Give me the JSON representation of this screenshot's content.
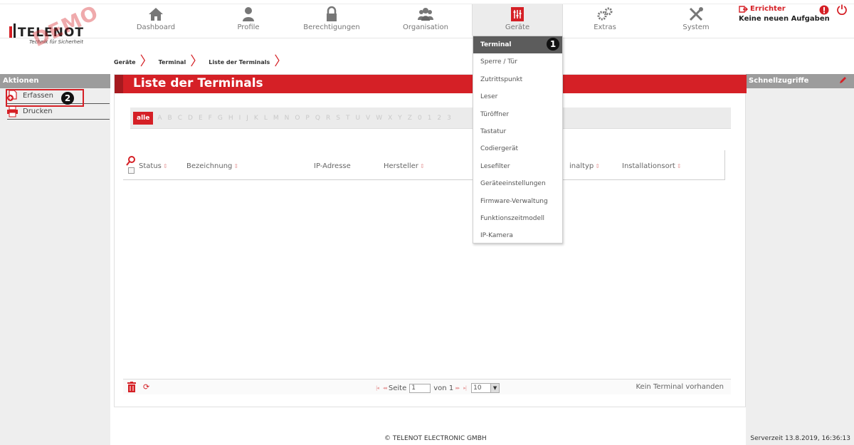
{
  "logo": {
    "brand": "TELENOT",
    "tagline": "Technik für Sicherheit",
    "watermark": "DEMO"
  },
  "nav": [
    {
      "label": "Dashboard",
      "icon": "house-icon"
    },
    {
      "label": "Profile",
      "icon": "person-icon"
    },
    {
      "label": "Berechtigungen",
      "icon": "lock-icon"
    },
    {
      "label": "Organisation",
      "icon": "group-icon"
    },
    {
      "label": "Geräte",
      "icon": "device-icon"
    },
    {
      "label": "Extras",
      "icon": "gears-icon"
    },
    {
      "label": "System",
      "icon": "tools-icon"
    }
  ],
  "user": {
    "name": "Errichter",
    "tasks": "Keine neuen Aufgaben"
  },
  "breadcrumb": [
    "Geräte",
    "Terminal",
    "Liste der Terminals"
  ],
  "sidebar": {
    "title": "Aktionen",
    "items": [
      {
        "label": "Erfassen",
        "icon": "add-document-icon"
      },
      {
        "label": "Drucken",
        "icon": "printer-icon"
      }
    ]
  },
  "right_sidebar": {
    "title": "Schnellzugriffe"
  },
  "main": {
    "title": "Liste der Terminals",
    "alpha_all": "alle",
    "letters": [
      "A",
      "B",
      "C",
      "D",
      "E",
      "F",
      "G",
      "H",
      "I",
      "J",
      "K",
      "L",
      "M",
      "N",
      "O",
      "P",
      "Q",
      "R",
      "S",
      "T",
      "U",
      "V",
      "W",
      "X",
      "Y",
      "Z",
      "0",
      "1",
      "2",
      "3"
    ],
    "columns": [
      "Status",
      "Bezeichnung",
      "IP-Adresse",
      "Hersteller",
      "Terminaltyp",
      "Installationsort"
    ],
    "columns_visible": [
      "Status",
      "Bezeichnung",
      "IP-Adresse",
      "Hersteller",
      "inaltyp",
      "Installationsort"
    ],
    "pager": {
      "page_label": "Seite",
      "page_value": "1",
      "of_label": "von 1",
      "page_size": "10"
    },
    "empty_text": "Kein Terminal vorhanden"
  },
  "dropdown": {
    "items": [
      "Terminal",
      "Sperre / Tür",
      "Zutrittspunkt",
      "Leser",
      "Türöffner",
      "Tastatur",
      "Codiergerät",
      "Lesefilter",
      "Geräteeinstellungen",
      "Firmware-Verwaltung",
      "Funktionszeitmodell",
      "IP-Kamera"
    ],
    "selected": "Terminal"
  },
  "badges": [
    "1",
    "2"
  ],
  "footer": {
    "copyright": "© TELENOT ELECTRONIC GMBH",
    "server_time": "Serverzeit 13.8.2019, 16:36:13"
  },
  "colors": {
    "accent": "#d52026",
    "sidebar_head": "#9c9c9c",
    "dropdown_selected": "#5c5c5c"
  }
}
